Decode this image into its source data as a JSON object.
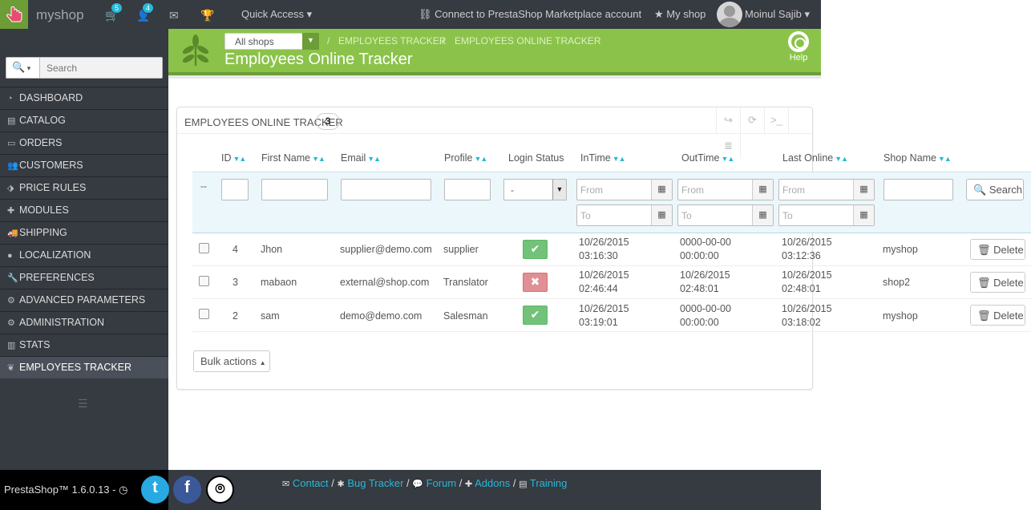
{
  "topbar": {
    "shop_name": "myshop",
    "orders_badge": "5",
    "customers_badge": "4",
    "quick_access": "Quick Access",
    "connect_link": "Connect to PrestaShop Marketplace account",
    "my_shop": "My shop",
    "user_name": "Moinul Sajib"
  },
  "sidebar": {
    "search_placeholder": "Search",
    "items": [
      {
        "label": "DASHBOARD",
        "icon": "dashboard-icon"
      },
      {
        "label": "CATALOG",
        "icon": "book-icon"
      },
      {
        "label": "ORDERS",
        "icon": "credit-card-icon"
      },
      {
        "label": "CUSTOMERS",
        "icon": "users-icon"
      },
      {
        "label": "PRICE RULES",
        "icon": "tag-icon"
      },
      {
        "label": "MODULES",
        "icon": "puzzle-icon"
      },
      {
        "label": "SHIPPING",
        "icon": "truck-icon"
      },
      {
        "label": "LOCALIZATION",
        "icon": "globe-icon"
      },
      {
        "label": "PREFERENCES",
        "icon": "wrench-icon"
      },
      {
        "label": "ADVANCED PARAMETERS",
        "icon": "cogs-icon"
      },
      {
        "label": "ADMINISTRATION",
        "icon": "cog-icon"
      },
      {
        "label": "STATS",
        "icon": "bar-chart-icon"
      },
      {
        "label": "EMPLOYEES TRACKER",
        "icon": "leaf-icon"
      }
    ],
    "version": "PrestaShop™ 1.6.0.13 -"
  },
  "header": {
    "shop_select": "All shops",
    "breadcrumb_1": "EMPLOYEES TRACKER",
    "breadcrumb_2": "EMPLOYEES ONLINE TRACKER",
    "title": "Employees Online Tracker",
    "help": "Help"
  },
  "panel": {
    "heading": "EMPLOYEES ONLINE TRACKER",
    "count": "3",
    "columns": {
      "id": "ID",
      "first_name": "First Name",
      "email": "Email",
      "profile": "Profile",
      "login_status": "Login Status",
      "in_time": "InTime",
      "out_time": "OutTime",
      "last_online": "Last Online",
      "shop_name": "Shop Name"
    },
    "filter": {
      "reset": "--",
      "status_value": "-",
      "from_placeholder": "From",
      "to_placeholder": "To",
      "search_button": "Search"
    },
    "rows": [
      {
        "id": "4",
        "first_name": "Jhon",
        "email": "supplier@demo.com",
        "profile": "supplier",
        "status": "online",
        "in_date": "10/26/2015",
        "in_time": "03:16:30",
        "out_date": "0000-00-00",
        "out_time": "00:00:00",
        "last_date": "10/26/2015",
        "last_time": "03:12:36",
        "shop": "myshop",
        "delete": "Delete"
      },
      {
        "id": "3",
        "first_name": "mabaon",
        "email": "external@shop.com",
        "profile": "Translator",
        "status": "offline",
        "in_date": "10/26/2015",
        "in_time": "02:46:44",
        "out_date": "10/26/2015",
        "out_time": "02:48:01",
        "last_date": "10/26/2015",
        "last_time": "02:48:01",
        "shop": "shop2",
        "delete": "Delete"
      },
      {
        "id": "2",
        "first_name": "sam",
        "email": "demo@demo.com",
        "profile": "Salesman",
        "status": "online",
        "in_date": "10/26/2015",
        "in_time": "03:19:01",
        "out_date": "0000-00-00",
        "out_time": "00:00:00",
        "last_date": "10/26/2015",
        "last_time": "03:18:02",
        "shop": "myshop",
        "delete": "Delete"
      }
    ],
    "bulk_actions": "Bulk actions"
  },
  "footer": {
    "contact": "Contact",
    "bug_tracker": "Bug Tracker",
    "forum": "Forum",
    "addons": "Addons",
    "training": "Training"
  },
  "colors": {
    "header_green": "#8bc34a",
    "sidebar_dark": "#363a41",
    "accent_blue": "#25b9d7",
    "status_ok": "#72c279",
    "status_no": "#e08f95"
  }
}
